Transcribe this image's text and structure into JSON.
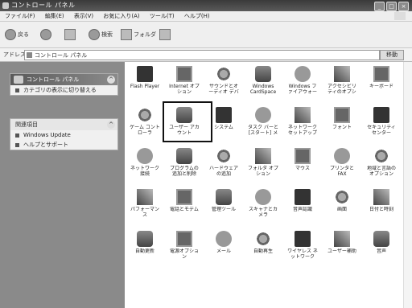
{
  "window": {
    "title": "コントロール パネル"
  },
  "menu": {
    "items": [
      "ファイル(F)",
      "編集(E)",
      "表示(V)",
      "お気に入り(A)",
      "ツール(T)",
      "ヘルプ(H)"
    ]
  },
  "toolbar": {
    "back": "戻る",
    "forward": "",
    "search": "検索",
    "folders": "フォルダ",
    "views": ""
  },
  "address": {
    "label": "アドレス(D)",
    "value": "コントロール パネル",
    "go": "移動"
  },
  "left": {
    "panel1": {
      "title": "コントロール パネル",
      "items": [
        "カテゴリの表示に切り替える"
      ]
    },
    "panel2": {
      "title": "関連項目",
      "items": [
        "Windows Update",
        "ヘルプとサポート"
      ]
    }
  },
  "items": [
    {
      "label": "Flash Player",
      "icon": "flash-icon",
      "style": "a"
    },
    {
      "label": "Internet オプション",
      "icon": "internet-options-icon",
      "style": "b"
    },
    {
      "label": "サウンドとオーディオ デバイス",
      "icon": "sound-icon",
      "style": "c"
    },
    {
      "label": "Windows CardSpace",
      "icon": "cardspace-icon",
      "style": "d"
    },
    {
      "label": "Windows ファイアウォール",
      "icon": "firewall-icon",
      "style": "e"
    },
    {
      "label": "アクセシビリティのオプション",
      "icon": "accessibility-icon",
      "style": "f"
    },
    {
      "label": "キーボード",
      "icon": "keyboard-icon",
      "style": "b"
    },
    {
      "label": "ゲーム コントローラ",
      "icon": "game-controller-icon",
      "style": "c"
    },
    {
      "label": "ユーザー アカウント",
      "icon": "user-accounts-icon",
      "style": "d"
    },
    {
      "label": "システム",
      "icon": "system-icon",
      "style": "a"
    },
    {
      "label": "タスク バーと [スタート] メニュー",
      "icon": "taskbar-icon",
      "style": "e"
    },
    {
      "label": "ネットワーク セットアップ ウィザード",
      "icon": "network-setup-icon",
      "style": "f"
    },
    {
      "label": "フォント",
      "icon": "fonts-icon",
      "style": "b"
    },
    {
      "label": "セキュリティ センター",
      "icon": "security-center-icon",
      "style": "a"
    },
    {
      "label": "ネットワーク接続",
      "icon": "network-connections-icon",
      "style": "e"
    },
    {
      "label": "プログラムの追加と削除",
      "icon": "add-remove-programs-icon",
      "style": "d"
    },
    {
      "label": "ハードウェアの追加",
      "icon": "add-hardware-icon",
      "style": "c"
    },
    {
      "label": "フォルダ オプション",
      "icon": "folder-options-icon",
      "style": "f"
    },
    {
      "label": "マウス",
      "icon": "mouse-icon",
      "style": "b"
    },
    {
      "label": "プリンタと FAX",
      "icon": "printers-icon",
      "style": "e"
    },
    {
      "label": "地域と言語のオプション",
      "icon": "regional-icon",
      "style": "c"
    },
    {
      "label": "パフォーマンス",
      "icon": "performance-icon",
      "style": "f"
    },
    {
      "label": "電話とモデム",
      "icon": "phone-modem-icon",
      "style": "b"
    },
    {
      "label": "管理ツール",
      "icon": "admin-tools-icon",
      "style": "d"
    },
    {
      "label": "スキャナとカメラ",
      "icon": "scanner-icon",
      "style": "e"
    },
    {
      "label": "音声認識",
      "icon": "speech-icon",
      "style": "a"
    },
    {
      "label": "画面",
      "icon": "display-icon",
      "style": "c"
    },
    {
      "label": "日付と時刻",
      "icon": "datetime-icon",
      "style": "f"
    },
    {
      "label": "自動更新",
      "icon": "auto-update-icon",
      "style": "d"
    },
    {
      "label": "電源オプション",
      "icon": "power-icon",
      "style": "b"
    },
    {
      "label": "メール",
      "icon": "mail-icon",
      "style": "e"
    },
    {
      "label": "自動再生",
      "icon": "autoplay-icon",
      "style": "c"
    },
    {
      "label": "ワイヤレス ネットワーク",
      "icon": "wireless-icon",
      "style": "a"
    },
    {
      "label": "ユーザー補助",
      "icon": "ease-icon",
      "style": "f"
    },
    {
      "label": "音声",
      "icon": "voice-icon",
      "style": "d"
    }
  ]
}
